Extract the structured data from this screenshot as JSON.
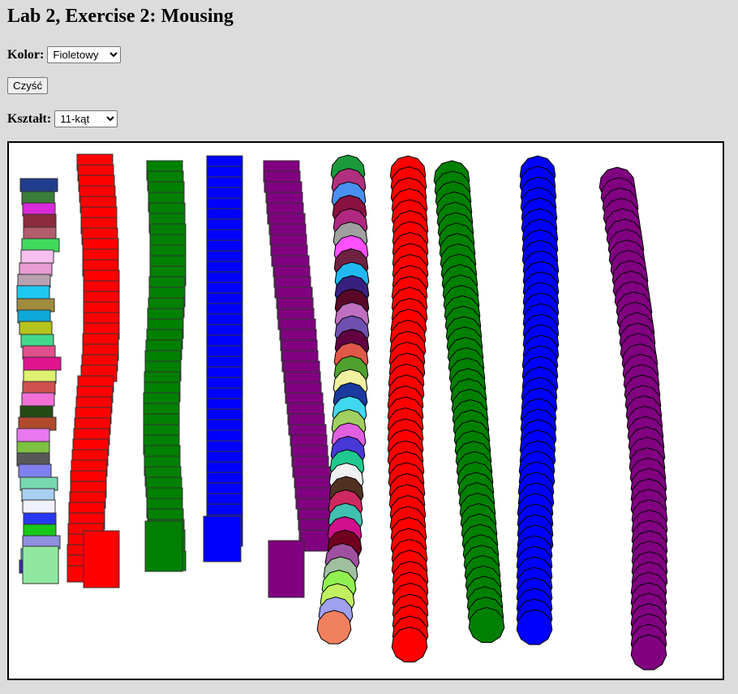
{
  "header": {
    "title": "Lab 2, Exercise 2: Mousing"
  },
  "controls": {
    "color_label": "Kolor:",
    "color_selected": "Fioletowy",
    "clear_button": "Czyść",
    "shape_label": "Kształt:",
    "shape_selected": "11-kąt"
  },
  "palette": {
    "red": "#ff0000",
    "green": "#008000",
    "blue": "#0000ff",
    "purple": "#800080",
    "background": "#dcdcdc",
    "canvas": "#ffffff"
  },
  "drawing": {
    "strokes": [
      {
        "shape": "square",
        "color": "multicolor"
      },
      {
        "shape": "square",
        "color": "red"
      },
      {
        "shape": "square",
        "color": "green"
      },
      {
        "shape": "square",
        "color": "blue"
      },
      {
        "shape": "square",
        "color": "purple"
      },
      {
        "shape": "11-gon",
        "color": "multicolor"
      },
      {
        "shape": "11-gon",
        "color": "red"
      },
      {
        "shape": "11-gon",
        "color": "green"
      },
      {
        "shape": "11-gon",
        "color": "blue"
      },
      {
        "shape": "11-gon",
        "color": "purple"
      }
    ]
  }
}
